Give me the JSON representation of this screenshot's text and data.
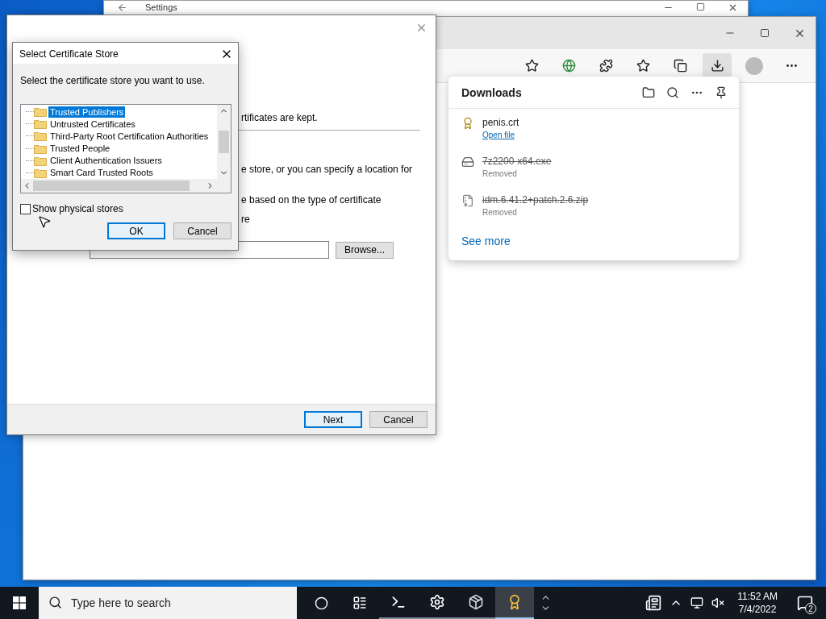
{
  "settings_window": {
    "title": "Settings"
  },
  "import_wizard": {
    "texts": [
      "rtificates are kept.",
      "e store, or you can specify a location for",
      "e based on the type of certificate",
      "re"
    ],
    "browse_button": "Browse...",
    "buttons": [
      {
        "label": "Next",
        "default": true
      },
      {
        "label": "Cancel",
        "default": false
      }
    ]
  },
  "store_dialog": {
    "title": "Select Certificate Store",
    "prompt": "Select the certificate store you want to use.",
    "stores": [
      {
        "label": "Trusted Publishers",
        "selected": true
      },
      {
        "label": "Untrusted Certificates",
        "selected": false
      },
      {
        "label": "Third-Party Root Certification Authorities",
        "selected": false
      },
      {
        "label": "Trusted People",
        "selected": false
      },
      {
        "label": "Client Authentication Issuers",
        "selected": false
      },
      {
        "label": "Smart Card Trusted Roots",
        "selected": false
      }
    ],
    "show_physical": {
      "label": "Show physical stores",
      "checked": false
    },
    "buttons": [
      {
        "label": "OK",
        "default": true
      },
      {
        "label": "Cancel",
        "default": false
      }
    ]
  },
  "downloads": {
    "title": "Downloads",
    "items": [
      {
        "kind": "certificate",
        "name": "penis.crt",
        "removed": false,
        "action": "Open file"
      },
      {
        "kind": "executable",
        "name": "7z2200-x64.exe",
        "removed": true,
        "status": "Removed"
      },
      {
        "kind": "archive",
        "name": "idm.6.41.2+patch.2.6.zip",
        "removed": true,
        "status": "Removed"
      }
    ],
    "see_more": "See more"
  },
  "taskbar": {
    "search": {
      "placeholder": "Type here to search"
    },
    "apps": [
      {
        "kind": "terminal",
        "running": true,
        "selected": false
      },
      {
        "kind": "settings",
        "running": true,
        "selected": false
      },
      {
        "kind": "installer",
        "running": true,
        "selected": false
      },
      {
        "kind": "certificate",
        "running": true,
        "selected": true
      }
    ],
    "clock": {
      "time": "11:52 AM",
      "date": "7/4/2022"
    },
    "notifications": {
      "count": "2"
    }
  }
}
